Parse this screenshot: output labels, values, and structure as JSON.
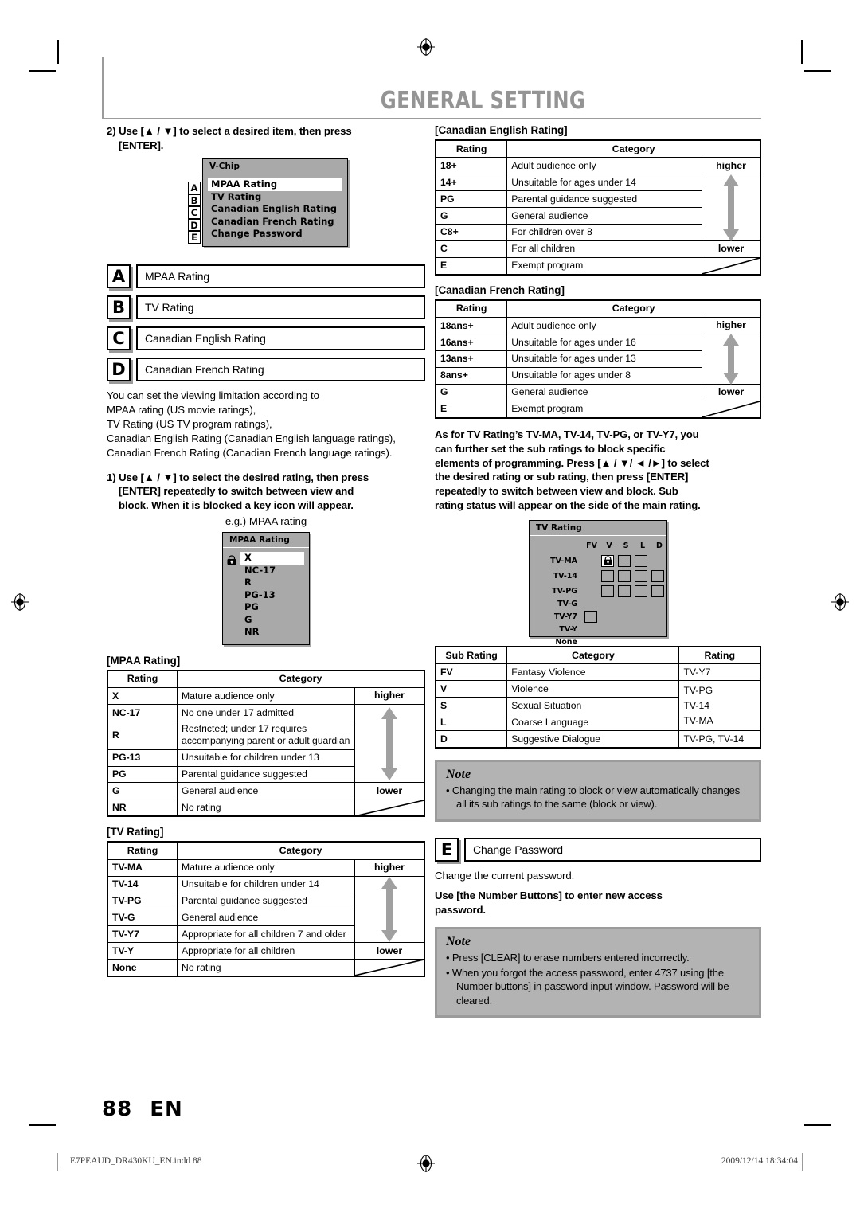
{
  "header": {
    "title": "GENERAL SETTING"
  },
  "left": {
    "step2": {
      "line1": "2) Use [▲ / ▼] to select a desired item, then press",
      "line2": "[ENTER]."
    },
    "vchip_osd": {
      "title": "V-Chip",
      "keys": [
        "A",
        "B",
        "C",
        "D",
        "E"
      ],
      "items": [
        "MPAA Rating",
        "TV Rating",
        "Canadian English Rating",
        "Canadian French Rating",
        "Change Password"
      ],
      "selected_index": 0,
      "arrow_icon": "right-triangle-icon"
    },
    "options": [
      {
        "letter": "A",
        "label": "MPAA Rating"
      },
      {
        "letter": "B",
        "label": "TV Rating"
      },
      {
        "letter": "C",
        "label": "Canadian English Rating"
      },
      {
        "letter": "D",
        "label": "Canadian French Rating"
      }
    ],
    "description": [
      "You can set the viewing limitation according to",
      "MPAA rating (US movie ratings),",
      "TV Rating (US TV program ratings),",
      "Canadian English Rating (Canadian English language ratings),",
      "Canadian French Rating (Canadian French language ratings)."
    ],
    "step1": {
      "line1": "1) Use [▲ / ▼] to select the desired rating, then press",
      "line2": "[ENTER] repeatedly to switch between view and",
      "line3": "block. When it is blocked a key icon will appear."
    },
    "eg_caption": "e.g.) MPAA rating",
    "mpaa_osd": {
      "title": "MPAA Rating",
      "lock_icon": "lock-icon",
      "items": [
        "X",
        "NC-17",
        "R",
        "PG-13",
        "PG",
        "G",
        "NR"
      ],
      "selected_index": 0
    },
    "mpaa_table": {
      "caption": "[MPAA Rating]",
      "columns": [
        "Rating",
        "Category"
      ],
      "higher_label": "higher",
      "lower_label": "lower",
      "rows": [
        {
          "rating": "X",
          "category": "Mature audience only"
        },
        {
          "rating": "NC-17",
          "category": "No one under 17 admitted"
        },
        {
          "rating": "R",
          "category": "Restricted; under 17 requires accompanying parent or adult guardian"
        },
        {
          "rating": "PG-13",
          "category": "Unsuitable for children under 13"
        },
        {
          "rating": "PG",
          "category": "Parental guidance suggested"
        },
        {
          "rating": "G",
          "category": "General audience"
        },
        {
          "rating": "NR",
          "category": "No rating"
        }
      ]
    },
    "tv_table": {
      "caption": "[TV Rating]",
      "columns": [
        "Rating",
        "Category"
      ],
      "higher_label": "higher",
      "lower_label": "lower",
      "rows": [
        {
          "rating": "TV-MA",
          "category": "Mature audience only"
        },
        {
          "rating": "TV-14",
          "category": "Unsuitable for children under 14"
        },
        {
          "rating": "TV-PG",
          "category": "Parental guidance suggested"
        },
        {
          "rating": "TV-G",
          "category": "General audience"
        },
        {
          "rating": "TV-Y7",
          "category": "Appropriate for all children 7 and older"
        },
        {
          "rating": "TV-Y",
          "category": "Appropriate for all children"
        },
        {
          "rating": "None",
          "category": "No rating"
        }
      ]
    }
  },
  "right": {
    "ce_table": {
      "caption": "[Canadian English Rating]",
      "columns": [
        "Rating",
        "Category"
      ],
      "higher_label": "higher",
      "lower_label": "lower",
      "rows": [
        {
          "rating": "18+",
          "category": "Adult audience only"
        },
        {
          "rating": "14+",
          "category": "Unsuitable for ages under 14"
        },
        {
          "rating": "PG",
          "category": "Parental guidance suggested"
        },
        {
          "rating": "G",
          "category": "General audience"
        },
        {
          "rating": "C8+",
          "category": "For children over 8"
        },
        {
          "rating": "C",
          "category": "For all children"
        },
        {
          "rating": "E",
          "category": "Exempt program"
        }
      ]
    },
    "cf_table": {
      "caption": "[Canadian French Rating]",
      "columns": [
        "Rating",
        "Category"
      ],
      "higher_label": "higher",
      "lower_label": "lower",
      "rows": [
        {
          "rating": "18ans+",
          "category": "Adult audience only"
        },
        {
          "rating": "16ans+",
          "category": "Unsuitable for ages under 16"
        },
        {
          "rating": "13ans+",
          "category": "Unsuitable for ages under 13"
        },
        {
          "rating": "8ans+",
          "category": "Unsuitable for ages under 8"
        },
        {
          "rating": "G",
          "category": "General audience"
        },
        {
          "rating": "E",
          "category": "Exempt program"
        }
      ]
    },
    "subrating_para": [
      "As for TV Rating’s TV-MA, TV-14, TV-PG, or TV-Y7, you",
      "can further set the sub ratings to block specific",
      "elements of programming. Press [▲ / ▼/ ◄ /►] to select",
      "the desired rating or sub rating, then press [ENTER]",
      "repeatedly to switch between view and block. Sub",
      "rating status will appear on the side of the main rating."
    ],
    "tvgrid_osd": {
      "title": "TV Rating",
      "columns": [
        "FV",
        "V",
        "S",
        "L",
        "D"
      ],
      "rows": [
        "TV-MA",
        "TV-14",
        "TV-PG",
        "TV-G",
        "TV-Y7",
        "TV-Y",
        "None"
      ],
      "lock_icon": "lock-icon"
    },
    "sub_table": {
      "columns": [
        "Sub Rating",
        "Category",
        "Rating"
      ],
      "rows": [
        {
          "sub": "FV",
          "category": "Fantasy Violence",
          "rating": "TV-Y7"
        },
        {
          "sub": "V",
          "category": "Violence",
          "rating": "TV-PG"
        },
        {
          "sub": "S",
          "category": "Sexual Situation",
          "rating": "TV-14"
        },
        {
          "sub": "L",
          "category": "Coarse Language",
          "rating": "TV-MA"
        },
        {
          "sub": "D",
          "category": "Suggestive Dialogue",
          "rating": "TV-PG, TV-14"
        }
      ]
    },
    "note1": {
      "title": "Note",
      "items": [
        "• Changing the main rating to block or view automatically changes all its sub ratings to the same (block or view)."
      ]
    },
    "option_e": {
      "letter": "E",
      "label": "Change Password"
    },
    "password_desc": "Change the current password.",
    "password_bold": {
      "line1": "Use [the Number Buttons] to enter new access",
      "line2": "password."
    },
    "note2": {
      "title": "Note",
      "items": [
        "• Press [CLEAR] to erase numbers entered incorrectly.",
        "• When you forgot the access password, enter 4737 using [the Number buttons] in password input window. Password will be cleared."
      ]
    }
  },
  "footer": {
    "page_number": "88",
    "language": "EN",
    "file_name": "E7PEAUD_DR430KU_EN.indd   88",
    "timestamp": "2009/12/14   18:34:04"
  },
  "colors": {
    "header_gray": "#949494",
    "osd_gray": "#a9a9a9",
    "note_bg": "#b3b3b3",
    "note_border": "#9b9b9b",
    "arrow_gray": "#a0a0a0"
  }
}
